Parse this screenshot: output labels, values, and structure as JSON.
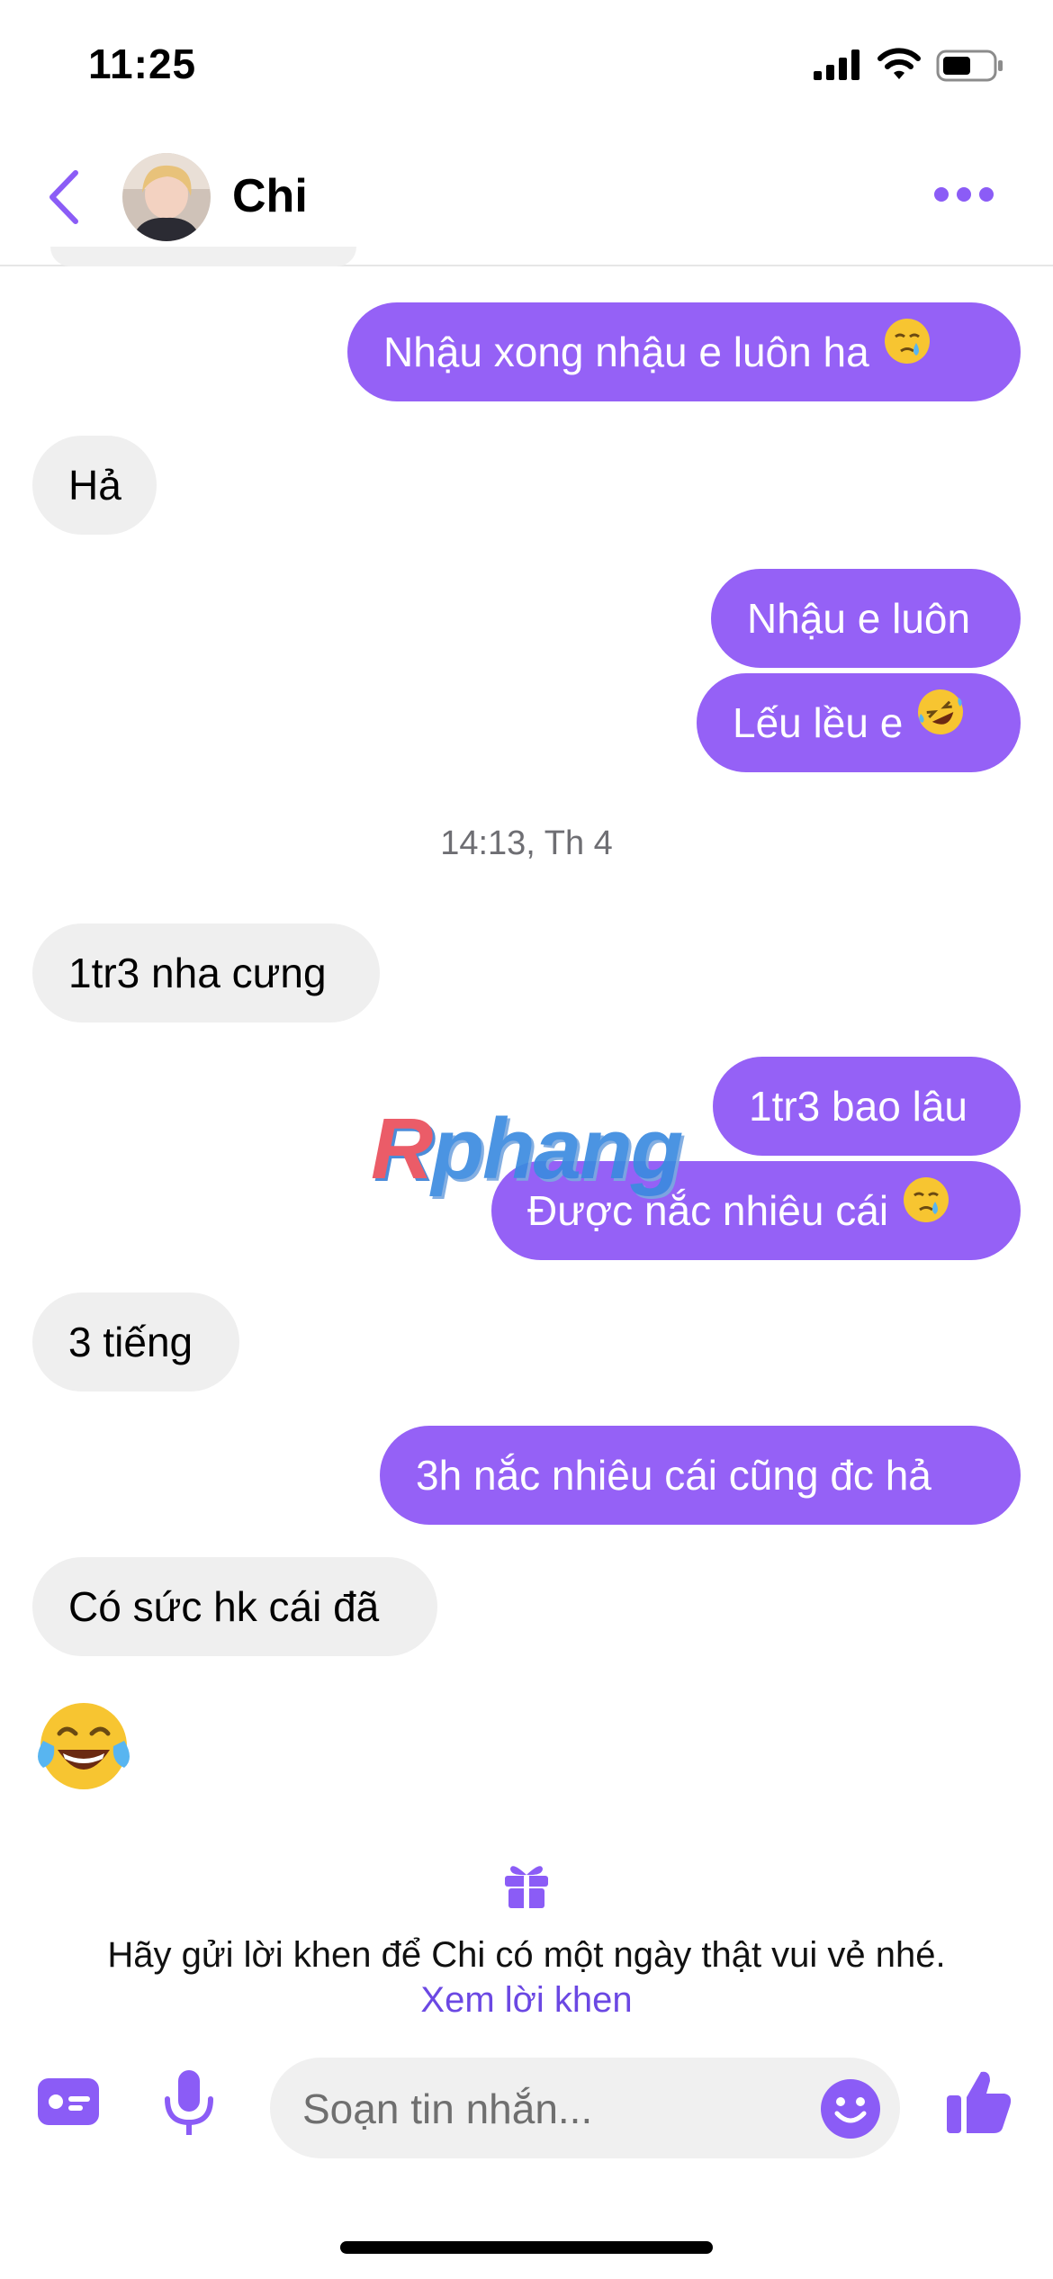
{
  "status_bar": {
    "time": "11:25"
  },
  "header": {
    "contact_name": "Chi"
  },
  "messages": [
    {
      "dir": "out",
      "text": "Nhậu xong nhậu e luôn ha",
      "emoji": "crying-face"
    },
    {
      "dir": "in",
      "text": "Hả"
    },
    {
      "dir": "out",
      "text": "Nhậu e luôn"
    },
    {
      "dir": "out",
      "text": "Lếu lều e",
      "emoji": "rolling-laughing-face"
    },
    {
      "dir": "in",
      "text": "1tr3 nha cưng"
    },
    {
      "dir": "out",
      "text": "1tr3 bao lâu"
    },
    {
      "dir": "out",
      "text": "Được nắc nhiêu cái",
      "emoji": "crying-face"
    },
    {
      "dir": "in",
      "text": "3 tiếng"
    },
    {
      "dir": "out",
      "text": "3h nắc nhiêu cái cũng đc hả"
    },
    {
      "dir": "in",
      "text": "Có sức hk cái đã"
    },
    {
      "dir": "in",
      "emoji": "tears-of-joy-face"
    }
  ],
  "timestamp": "14:13, Th 4",
  "watermark": {
    "part1": "R",
    "part2": "phang"
  },
  "compliment_prompt": {
    "text": "Hãy gửi lời khen để Chi có một ngày thật vui vẻ nhé.",
    "link": "Xem lời khen"
  },
  "composer": {
    "placeholder": "Soạn tin nhắn..."
  },
  "colors": {
    "accent": "#9561f6",
    "incoming_bubble": "#efefef",
    "link": "#6b48e3"
  },
  "icons": [
    "back-chevron-icon",
    "more-dots-icon",
    "gift-icon",
    "card-icon",
    "microphone-icon",
    "smile-icon",
    "thumbs-up-icon"
  ]
}
